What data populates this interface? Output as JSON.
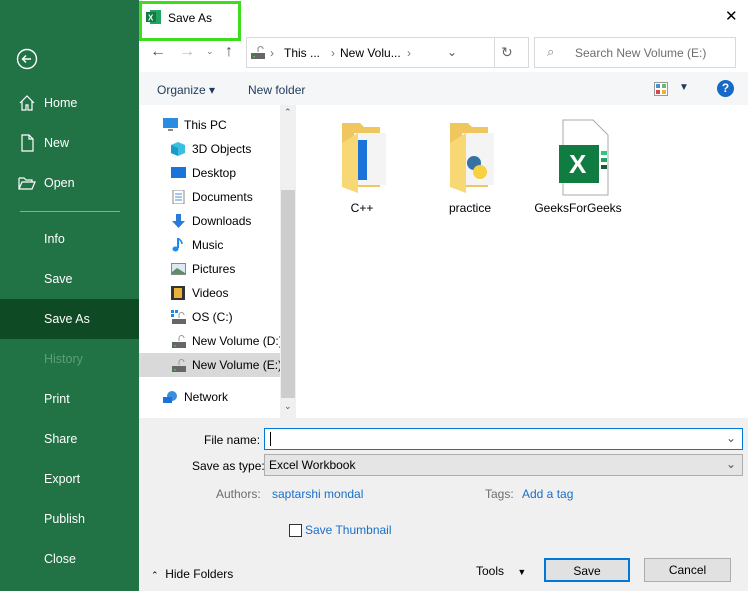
{
  "sidebar": {
    "items": [
      {
        "label": "Home",
        "icon": "home-icon"
      },
      {
        "label": "New",
        "icon": "new-document-icon"
      },
      {
        "label": "Open",
        "icon": "open-folder-icon"
      },
      {
        "label": "Info"
      },
      {
        "label": "Save"
      },
      {
        "label": "Save As",
        "selected": true
      },
      {
        "label": "History",
        "disabled": true
      },
      {
        "label": "Print"
      },
      {
        "label": "Share"
      },
      {
        "label": "Export"
      },
      {
        "label": "Publish"
      },
      {
        "label": "Close"
      }
    ]
  },
  "dialog": {
    "title": "Save As",
    "close": "✕"
  },
  "address": {
    "crumbs": [
      "This ...",
      "New Volu..."
    ],
    "search_placeholder": "Search New Volume (E:)"
  },
  "toolbar": {
    "organize": "Organize",
    "new_folder": "New folder",
    "help": "?"
  },
  "tree": {
    "root": "This PC",
    "items": [
      "3D Objects",
      "Desktop",
      "Documents",
      "Downloads",
      "Music",
      "Pictures",
      "Videos",
      "OS (C:)",
      "New Volume (D:)",
      "New Volume (E:)"
    ],
    "selected": "New Volume (E:)",
    "network": "Network"
  },
  "files": [
    {
      "name": "C++",
      "type": "folder"
    },
    {
      "name": "practice",
      "type": "folder"
    },
    {
      "name": "GeeksForGeeks",
      "type": "excel-file"
    }
  ],
  "form": {
    "file_name_label": "File name:",
    "file_name_value": "",
    "save_type_label": "Save as type:",
    "save_type_value": "Excel Workbook",
    "authors_label": "Authors:",
    "authors_value": "saptarshi mondal",
    "tags_label": "Tags:",
    "tags_value": "Add a tag",
    "thumbnail_label": "Save Thumbnail"
  },
  "footer": {
    "hide_folders": "Hide Folders",
    "tools": "Tools",
    "save": "Save",
    "cancel": "Cancel"
  },
  "colors": {
    "excel_green": "#217346",
    "selected_green": "#0e4a24",
    "accent_blue": "#0078d7"
  }
}
